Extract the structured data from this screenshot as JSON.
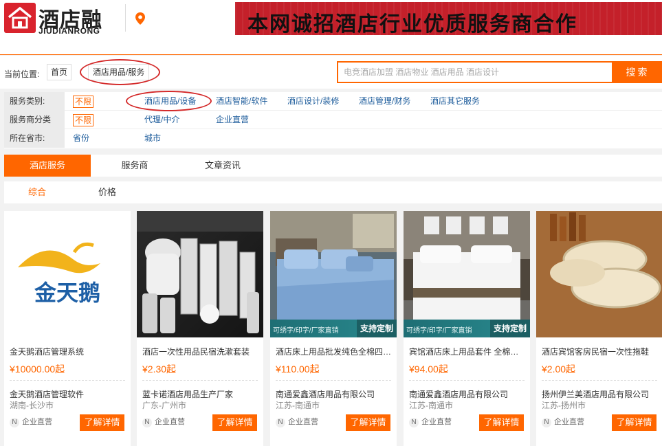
{
  "header": {
    "logo_cn": "酒店融",
    "logo_en": "JIUDIANRONG",
    "banner_text": "本网诚招酒店行业优质服务商合作"
  },
  "breadcrumb": {
    "label": "当前位置:",
    "home": "首页",
    "current": "酒店用品/服务"
  },
  "search": {
    "placeholder": "电竞酒店加盟 酒店物业 酒店用品 酒店设计",
    "button": "搜索"
  },
  "filters": [
    {
      "label": "服务类别:",
      "all": "不限",
      "options": [
        "酒店用品/设备",
        "酒店智能/软件",
        "酒店设计/装修",
        "酒店管理/财务",
        "酒店其它服务"
      ]
    },
    {
      "label": "服务商分类",
      "all": "不限",
      "options": [
        "代理/中介",
        "企业直营"
      ]
    },
    {
      "label": "所在省市:",
      "all": "",
      "options": [
        "省份",
        "城市"
      ]
    }
  ],
  "tabs": [
    "酒店服务",
    "服务商",
    "文章资讯"
  ],
  "sorts": [
    "综合",
    "价格"
  ],
  "products": [
    {
      "title": "金天鹅酒店管理系统",
      "price": "¥10000.00起",
      "company": "金天鹅酒店管理软件",
      "city": "湖南-长沙市",
      "badge": "企业直营",
      "badge_letter": "N",
      "button": "了解详情",
      "logo_text": "金天鹅"
    },
    {
      "title": "酒店一次性用品民宿洗漱套装",
      "price": "¥2.30起",
      "company": "蓝卡诺酒店用品生产厂家",
      "city": "广东-广州市",
      "badge": "企业直营",
      "badge_letter": "N",
      "button": "了解详情"
    },
    {
      "title": "酒店床上用品批发纯色全棉四件套",
      "price": "¥110.00起",
      "company": "南通爱鑫酒店用品有限公司",
      "city": "江苏-南通市",
      "badge": "企业直营",
      "badge_letter": "N",
      "button": "了解详情",
      "ribbon_left": "可绣字/印字/厂家直销",
      "ribbon_right": "支持定制"
    },
    {
      "title": "宾馆酒店床上用品套件 全棉白色",
      "price": "¥94.00起",
      "company": "南通爱鑫酒店用品有限公司",
      "city": "江苏-南通市",
      "badge": "企业直营",
      "badge_letter": "N",
      "button": "了解详情",
      "ribbon_left": "可绣字/印字/厂家直销",
      "ribbon_right": "支持定制"
    },
    {
      "title": "酒店宾馆客房民宿一次性拖鞋",
      "price": "¥2.00起",
      "company": "扬州伊兰美酒店用品有限公司",
      "city": "江苏-扬州市",
      "badge": "企业直营",
      "badge_letter": "N",
      "button": "了解详情"
    }
  ]
}
